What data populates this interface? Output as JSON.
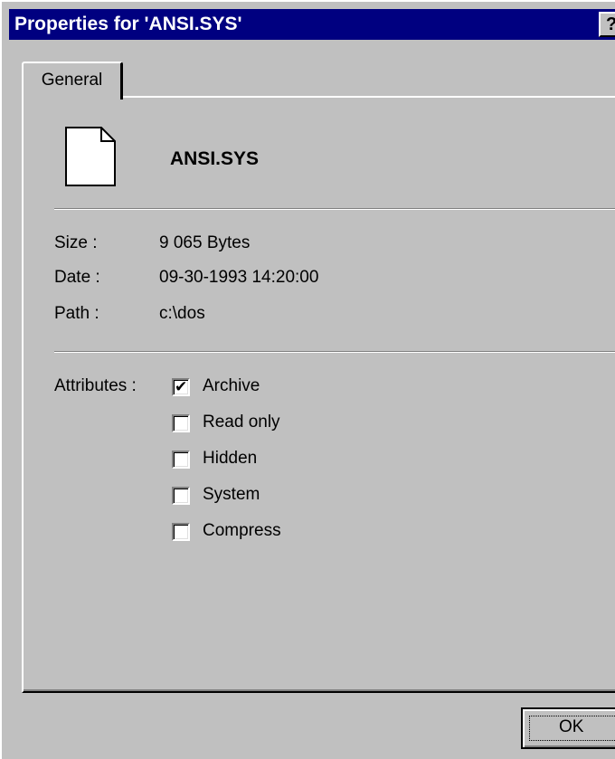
{
  "window": {
    "title": "Properties for  'ANSI.SYS'",
    "help_label": "?"
  },
  "tabs": [
    {
      "label": "General",
      "selected": true
    }
  ],
  "file": {
    "icon": "document-icon",
    "name": "ANSI.SYS"
  },
  "details": {
    "size_label": "Size :",
    "size_value": "9 065 Bytes",
    "date_label": "Date :",
    "date_value": "09-30-1993 14:20:00",
    "path_label": "Path :",
    "path_value": "c:\\dos"
  },
  "attributes": {
    "label": "Attributes :",
    "items": [
      {
        "label": "Archive",
        "checked": true
      },
      {
        "label": "Read only",
        "checked": false
      },
      {
        "label": "Hidden",
        "checked": false
      },
      {
        "label": "System",
        "checked": false
      },
      {
        "label": "Compress",
        "checked": false
      }
    ]
  },
  "buttons": {
    "ok_label": "OK"
  },
  "colors": {
    "titlebar": "#000080",
    "face": "#c0c0c0"
  }
}
